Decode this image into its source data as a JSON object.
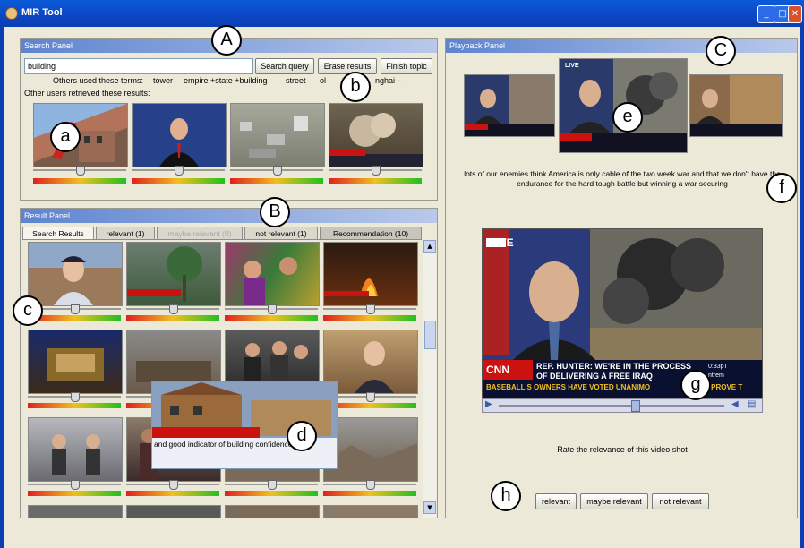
{
  "window": {
    "title": "MIR Tool",
    "min_icon": "minimize-icon",
    "max_icon": "maximize-icon",
    "close_icon": "close-icon"
  },
  "search_panel": {
    "title": "Search Panel",
    "query_value": "building",
    "search_button": "Search query",
    "erase_button": "Erase results",
    "finish_button": "Finish topic",
    "others_terms_label": "Others used these terms:",
    "terms": [
      "tower",
      "empire +state +building",
      "street",
      "ol",
      "nghai",
      "-"
    ],
    "others_results_label": "Other users retrieved these results:",
    "thumbs": [
      {
        "scene": "building-demolition",
        "relevance": 0.5
      },
      {
        "scene": "news-anchor",
        "relevance": 0.5
      },
      {
        "scene": "aerial-city",
        "relevance": 0.5
      },
      {
        "scene": "explosion-city",
        "relevance": 0.5
      }
    ]
  },
  "playback_panel": {
    "title": "Playback Panel",
    "keyframes": [
      "cnn-soldiers",
      "cnn-smoke-live",
      "cnn-street"
    ],
    "keyframe_live": "LIVE",
    "transcript": "lots of our enemies think America is only cable of the two week war and that we don't have the endurance for the hard tough battle but winning a war securing",
    "video": {
      "live": "LIVE",
      "ticker_line1": "REP. HUNTER: WE'RE IN THE PROCESS",
      "ticker_line2": "OF DELIVERING A FREE IRAQ",
      "ticker_line3": "BASEBALL'S OWNERS HAVE VOTED UNANIMO",
      "ticker_line3b": "APPROVE T",
      "time": "0:33pT",
      "clock": "ntrem",
      "network": "CNN",
      "progress": 0.6
    },
    "rate_prompt": "Rate the relevance of this video shot",
    "rate_buttons": [
      "relevant",
      "maybe relevant",
      "not relevant"
    ]
  },
  "result_panel": {
    "title": "Result Panel",
    "tabs": [
      "Search Results",
      "relevant (1)",
      "maybe relevant (0)",
      "not relevant (1)",
      "Recommendation (10)"
    ],
    "grid": [
      {
        "scene": "man-cap-house",
        "relevance": 0.5
      },
      {
        "scene": "storm-tree",
        "relevance": 0.5
      },
      {
        "scene": "crowd-colorful",
        "relevance": 0.5
      },
      {
        "scene": "fire-building",
        "relevance": 0.5
      },
      {
        "scene": "studio-set",
        "relevance": 0.5
      },
      {
        "scene": "crowd-street",
        "relevance": 0.5
      },
      {
        "scene": "politicians-handshake",
        "relevance": 0.5
      },
      {
        "scene": "man-interview",
        "relevance": 0.5
      },
      {
        "scene": "studio-interview",
        "relevance": 0.5
      },
      {
        "scene": "street-walk",
        "relevance": 0.5
      },
      {
        "scene": "crowd-wall",
        "relevance": 0.5
      },
      {
        "scene": "rubble-field",
        "relevance": 0.5
      }
    ],
    "tooltip": "and good indicator of building confidence think"
  },
  "annotations": {
    "A": "A",
    "B": "B",
    "C": "C",
    "a": "a",
    "b": "b",
    "c": "c",
    "d": "d",
    "e": "e",
    "f": "f",
    "g": "g",
    "h": "h"
  },
  "colors": {
    "titlebar": "#0d47c7",
    "panel_header": "#5e84d0",
    "bar_red": "#e02020",
    "bar_green": "#20c020"
  }
}
